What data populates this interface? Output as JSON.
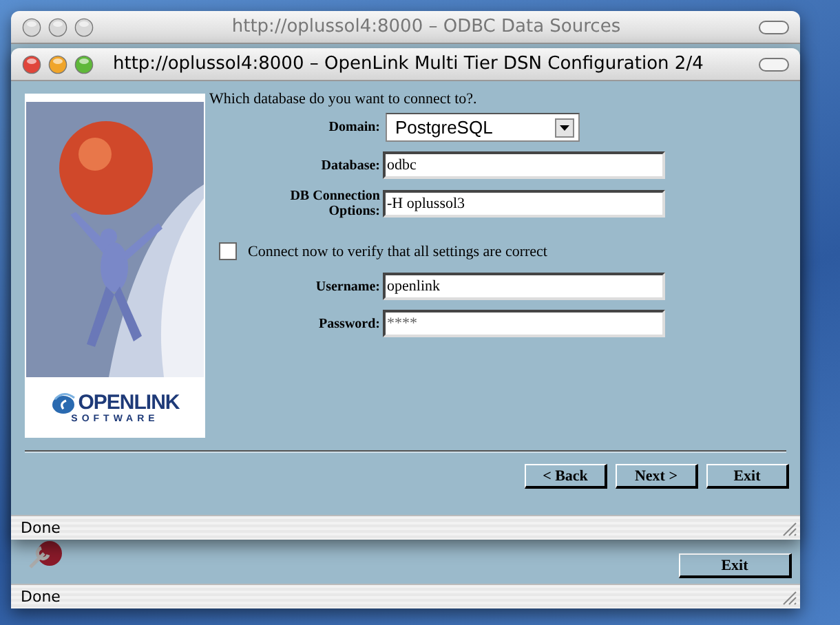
{
  "back_window": {
    "title": "http://oplussol4:8000 – ODBC Data Sources",
    "active": false,
    "buttons": [
      "Exit"
    ],
    "status_bar": "Done"
  },
  "front_window": {
    "title": "http://oplussol4:8000 – OpenLink Multi Tier DSN Configuration 2/4",
    "active": true,
    "prompt": "Which database do you want to connect to?.",
    "logo": {
      "name": "OPENLINK",
      "tagline": "SOFTWARE"
    },
    "fields": [
      {
        "kind": "select",
        "label": "Domain:",
        "value": "PostgreSQL"
      },
      {
        "kind": "text",
        "label": "Database:",
        "value": "odbc"
      },
      {
        "kind": "text",
        "label": "DB Connection Options:",
        "value": "-H oplussol3"
      },
      {
        "kind": "checkbox",
        "label": "Connect now to verify that all settings are correct",
        "checked": false
      },
      {
        "kind": "text",
        "label": "Username:",
        "value": "openlink"
      },
      {
        "kind": "password",
        "label": "Password:",
        "value": "****"
      }
    ],
    "buttons": [
      "< Back",
      "Next >",
      "Exit"
    ],
    "status_bar": "Done"
  }
}
